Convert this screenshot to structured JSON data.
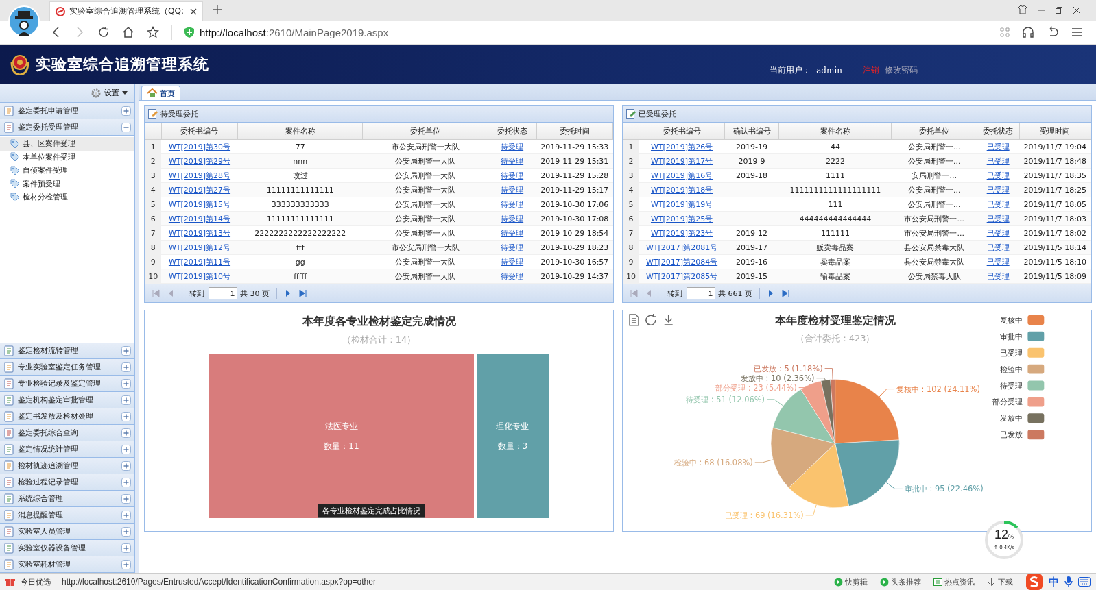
{
  "browser": {
    "tab_title": "实验室综合追溯管理系统（QQ:",
    "url_host": "http://localhost",
    "url_rest": ":2610/MainPage2019.aspx"
  },
  "header": {
    "title": "实验室综合追溯管理系统",
    "user_label": "当前用户：",
    "user": "admin",
    "logout": "注销",
    "change_password": "修改密码"
  },
  "sidebar": {
    "settings": "设置",
    "groups": [
      {
        "label": "鉴定委托申请管理",
        "expanded": false
      },
      {
        "label": "鉴定委托受理管理",
        "expanded": true,
        "children": [
          {
            "label": "县、区案件受理",
            "selected": true
          },
          {
            "label": "本单位案件受理",
            "selected": false
          },
          {
            "label": "自侦案件受理",
            "selected": false
          },
          {
            "label": "案件预受理",
            "selected": false
          },
          {
            "label": "检材分检管理",
            "selected": false
          }
        ]
      },
      {
        "label": "鉴定检材流转管理",
        "expanded": false
      },
      {
        "label": "专业实验室鉴定任务管理",
        "expanded": false
      },
      {
        "label": "专业检验记录及鉴定管理",
        "expanded": false
      },
      {
        "label": "鉴定机构鉴定审批管理",
        "expanded": false
      },
      {
        "label": "鉴定书发放及检材处理",
        "expanded": false
      },
      {
        "label": "鉴定委托综合查询",
        "expanded": false
      },
      {
        "label": "鉴定情况统计管理",
        "expanded": false
      },
      {
        "label": "检材轨迹追溯管理",
        "expanded": false
      },
      {
        "label": "检验过程记录管理",
        "expanded": false
      },
      {
        "label": "系统综合管理",
        "expanded": false
      },
      {
        "label": "消息提醒管理",
        "expanded": false
      },
      {
        "label": "实验室人员管理",
        "expanded": false
      },
      {
        "label": "实验室仪器设备管理",
        "expanded": false
      },
      {
        "label": "实验室耗材管理",
        "expanded": false
      }
    ]
  },
  "tabs": [
    {
      "label": "首页",
      "selected": true
    }
  ],
  "grids": [
    {
      "title": "待受理委托",
      "columns": [
        "委托书编号",
        "案件名称",
        "委托单位",
        "委托状态",
        "委托时间"
      ],
      "rows": [
        {
          "index": "1",
          "cells": [
            "WT[2019]第30号",
            "77",
            "市公安局刑警一大队",
            "待受理",
            "2019-11-29 15:33"
          ]
        },
        {
          "index": "2",
          "cells": [
            "WT[2019]第29号",
            "nnn",
            "公安局刑警一大队",
            "待受理",
            "2019-11-29 15:31"
          ]
        },
        {
          "index": "3",
          "cells": [
            "WT[2019]第28号",
            "改过",
            "公安局刑警一大队",
            "待受理",
            "2019-11-29 15:28"
          ]
        },
        {
          "index": "4",
          "cells": [
            "WT[2019]第27号",
            "11111111111111",
            "公安局刑警一大队",
            "待受理",
            "2019-11-29 15:17"
          ]
        },
        {
          "index": "5",
          "cells": [
            "WT[2019]第15号",
            "333333333333",
            "公安局刑警一大队",
            "待受理",
            "2019-10-30 17:06"
          ]
        },
        {
          "index": "6",
          "cells": [
            "WT[2019]第14号",
            "11111111111111",
            "公安局刑警一大队",
            "待受理",
            "2019-10-30 17:08"
          ]
        },
        {
          "index": "7",
          "cells": [
            "WT[2019]第13号",
            "2222222222222222222",
            "公安局刑警一大队",
            "待受理",
            "2019-10-29 18:54"
          ]
        },
        {
          "index": "8",
          "cells": [
            "WT[2019]第12号",
            "fff",
            "市公安局刑警一大队",
            "待受理",
            "2019-10-29 18:23"
          ]
        },
        {
          "index": "9",
          "cells": [
            "WT[2019]第11号",
            "gg",
            "公安局刑警一大队",
            "待受理",
            "2019-10-30 16:57"
          ]
        },
        {
          "index": "10",
          "cells": [
            "WT[2019]第10号",
            "fffff",
            "公安局刑警一大队",
            "待受理",
            "2019-10-29 14:37"
          ]
        }
      ],
      "pager": {
        "goto": "转到",
        "page": "1",
        "total": "共 30 页"
      }
    },
    {
      "title": "已受理委托",
      "columns": [
        "委托书编号",
        "确认书编号",
        "案件名称",
        "委托单位",
        "委托状态",
        "受理时间"
      ],
      "rows": [
        {
          "index": "1",
          "cells": [
            "WT[2019]第26号",
            "2019-19",
            "44",
            "公安局刑警一...",
            "已受理",
            "2019/11/7 19:04"
          ]
        },
        {
          "index": "2",
          "cells": [
            "WT[2019]第17号",
            "2019-9",
            "2222",
            "公安局刑警一...",
            "已受理",
            "2019/11/7 18:48"
          ]
        },
        {
          "index": "3",
          "cells": [
            "WT[2019]第16号",
            "2019-18",
            "1111",
            "安局刑警一...",
            "已受理",
            "2019/11/7 18:35"
          ]
        },
        {
          "index": "4",
          "cells": [
            "WT[2019]第18号",
            "",
            "1111111111111111111",
            "公安局刑警一...",
            "已受理",
            "2019/11/7 18:25"
          ]
        },
        {
          "index": "5",
          "cells": [
            "WT[2019]第19号",
            "",
            "111",
            "公安局刑警一...",
            "已受理",
            "2019/11/7 18:05"
          ]
        },
        {
          "index": "6",
          "cells": [
            "WT[2019]第25号",
            "",
            "444444444444444",
            "市公安局刑警一...",
            "已受理",
            "2019/11/7 18:03"
          ]
        },
        {
          "index": "7",
          "cells": [
            "WT[2019]第23号",
            "2019-12",
            "111111",
            "市公安局刑警一...",
            "已受理",
            "2019/11/7 18:02"
          ]
        },
        {
          "index": "8",
          "cells": [
            "WT[2017]第2081号",
            "2019-17",
            "贩卖毒品案",
            "县公安局禁毒大队",
            "已受理",
            "2019/11/5 18:14"
          ]
        },
        {
          "index": "9",
          "cells": [
            "WT[2017]第2084号",
            "2019-16",
            "卖毒品案",
            "县公安局禁毒大队",
            "已受理",
            "2019/11/5 18:10"
          ]
        },
        {
          "index": "10",
          "cells": [
            "WT[2017]第2085号",
            "2019-15",
            "输毒品案",
            "公安局禁毒大队",
            "已受理",
            "2019/11/5 18:09"
          ]
        }
      ],
      "pager": {
        "goto": "转到",
        "page": "1",
        "total": "共 661 页"
      }
    }
  ],
  "treemap": {
    "title": "本年度各专业检材鉴定完成情况",
    "subtitle": "（检材合计：14）",
    "tooltip": "各专业检材鉴定完成占比情况",
    "tiles": [
      {
        "name": "法医专业",
        "count_label": "数量：",
        "count": "11",
        "color": "#d87c7c"
      },
      {
        "name": "理化专业",
        "count_label": "数量：",
        "count": "3",
        "color": "#61a0a8"
      }
    ]
  },
  "pie": {
    "chart_data": {
      "type": "pie",
      "title": "本年度检材受理鉴定情况",
      "categories": [
        "复核中",
        "审批中",
        "已受理",
        "检验中",
        "待受理",
        "部分受理",
        "发放中",
        "已发放"
      ],
      "values": [
        102,
        95,
        69,
        68,
        51,
        23,
        10,
        5
      ],
      "colors": [
        "#e8834a",
        "#61a0a8",
        "#fac36e",
        "#d6a97e",
        "#93c6ad",
        "#ef9f8a",
        "#77715f",
        "#cc7960"
      ],
      "value_labels": [
        "复核中 : 102 (24.11%)",
        "审批中 : 95 (22.46%)",
        "已受理 : 69 (16.31%)",
        "检验中 : 68 (16.08%)",
        "待受理 : 51 (12.06%)",
        "部分受理 : 23 (5.44%)",
        "发放中 : 10 (2.36%)",
        "已发放 : 5 (1.18%)"
      ],
      "legend": "right"
    },
    "subtitle": "（合计委托：423）"
  },
  "speed": {
    "percent": "12",
    "unit": "%",
    "rate": "↑ 0.4K/s"
  },
  "status_bar": {
    "left": "今日优选",
    "url": "http://localhost:2610/Pages/EntrustedAccept/IdentificationConfirmation.aspx?op=other",
    "items": [
      "快剪辑",
      "头条推荐",
      "热点资讯",
      "下载"
    ],
    "ime": "中"
  }
}
